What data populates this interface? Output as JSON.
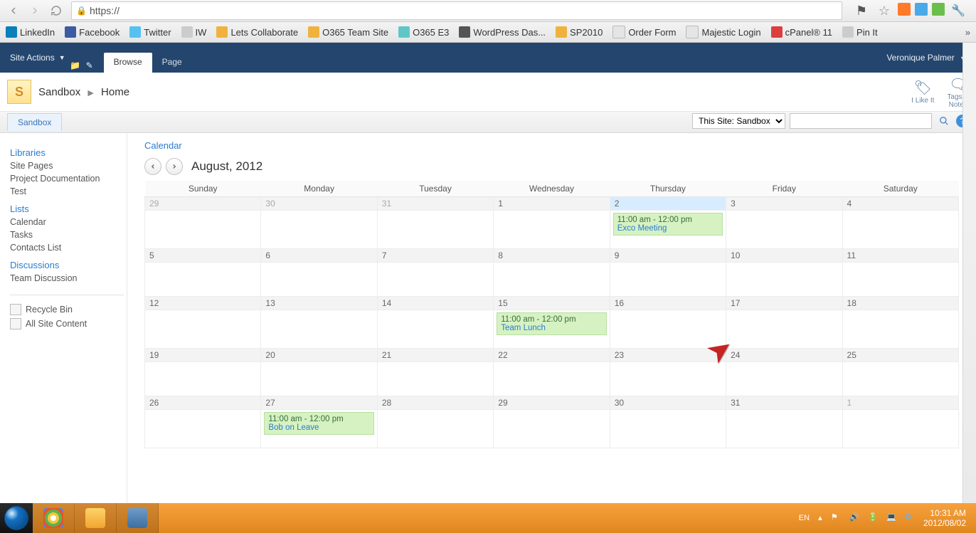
{
  "browser": {
    "url_prefix": "https://",
    "bookmarks": [
      {
        "label": "LinkedIn",
        "icon": "linkedin"
      },
      {
        "label": "Facebook",
        "icon": "fb"
      },
      {
        "label": "Twitter",
        "icon": "tw"
      },
      {
        "label": "IW",
        "icon": "grey"
      },
      {
        "label": "Lets Collaborate",
        "icon": "orange"
      },
      {
        "label": "O365 Team Site",
        "icon": "orange"
      },
      {
        "label": "O365 E3",
        "icon": "teal"
      },
      {
        "label": "WordPress Das...",
        "icon": "dark"
      },
      {
        "label": "SP2010",
        "icon": "orange"
      },
      {
        "label": "Order Form",
        "icon": "gm"
      },
      {
        "label": "Majestic Login",
        "icon": "gm"
      },
      {
        "label": "cPanel® 11",
        "icon": "red"
      },
      {
        "label": "Pin It",
        "icon": "grey"
      }
    ]
  },
  "ribbon": {
    "site_actions": "Site Actions",
    "tabs": {
      "browse": "Browse",
      "page": "Page"
    },
    "user": "Veronique Palmer"
  },
  "title_bar": {
    "site": "Sandbox",
    "page": "Home",
    "like": "I Like It",
    "tags": "Tags &\nNotes"
  },
  "secondary": {
    "nav_tab": "Sandbox",
    "search_scope": "This Site: Sandbox"
  },
  "sidebar": {
    "libraries_header": "Libraries",
    "libraries": [
      "Site Pages",
      "Project Documentation",
      "Test"
    ],
    "lists_header": "Lists",
    "lists": [
      "Calendar",
      "Tasks",
      "Contacts List"
    ],
    "discussions_header": "Discussions",
    "discussions": [
      "Team Discussion"
    ],
    "recycle": "Recycle Bin",
    "all_content": "All Site Content"
  },
  "calendar": {
    "heading": "Calendar",
    "month": "August, 2012",
    "days": [
      "Sunday",
      "Monday",
      "Tuesday",
      "Wednesday",
      "Thursday",
      "Friday",
      "Saturday"
    ],
    "weeks": [
      [
        {
          "n": "29",
          "out": true
        },
        {
          "n": "30",
          "out": true
        },
        {
          "n": "31",
          "out": true
        },
        {
          "n": "1"
        },
        {
          "n": "2",
          "today": true,
          "event": {
            "time": "11:00 am - 12:00 pm",
            "title": "Exco Meeting"
          }
        },
        {
          "n": "3"
        },
        {
          "n": "4"
        }
      ],
      [
        {
          "n": "5"
        },
        {
          "n": "6"
        },
        {
          "n": "7"
        },
        {
          "n": "8"
        },
        {
          "n": "9"
        },
        {
          "n": "10"
        },
        {
          "n": "11"
        }
      ],
      [
        {
          "n": "12"
        },
        {
          "n": "13"
        },
        {
          "n": "14"
        },
        {
          "n": "15",
          "event": {
            "time": "11:00 am - 12:00 pm",
            "title": "Team Lunch"
          }
        },
        {
          "n": "16"
        },
        {
          "n": "17"
        },
        {
          "n": "18"
        }
      ],
      [
        {
          "n": "19"
        },
        {
          "n": "20"
        },
        {
          "n": "21"
        },
        {
          "n": "22"
        },
        {
          "n": "23"
        },
        {
          "n": "24"
        },
        {
          "n": "25"
        }
      ],
      [
        {
          "n": "26"
        },
        {
          "n": "27",
          "event": {
            "time": "11:00 am - 12:00 pm",
            "title": "Bob on Leave"
          }
        },
        {
          "n": "28"
        },
        {
          "n": "29"
        },
        {
          "n": "30"
        },
        {
          "n": "31"
        },
        {
          "n": "1",
          "out": true
        }
      ]
    ]
  },
  "taskbar": {
    "lang": "EN",
    "time": "10:31 AM",
    "date": "2012/08/02"
  }
}
